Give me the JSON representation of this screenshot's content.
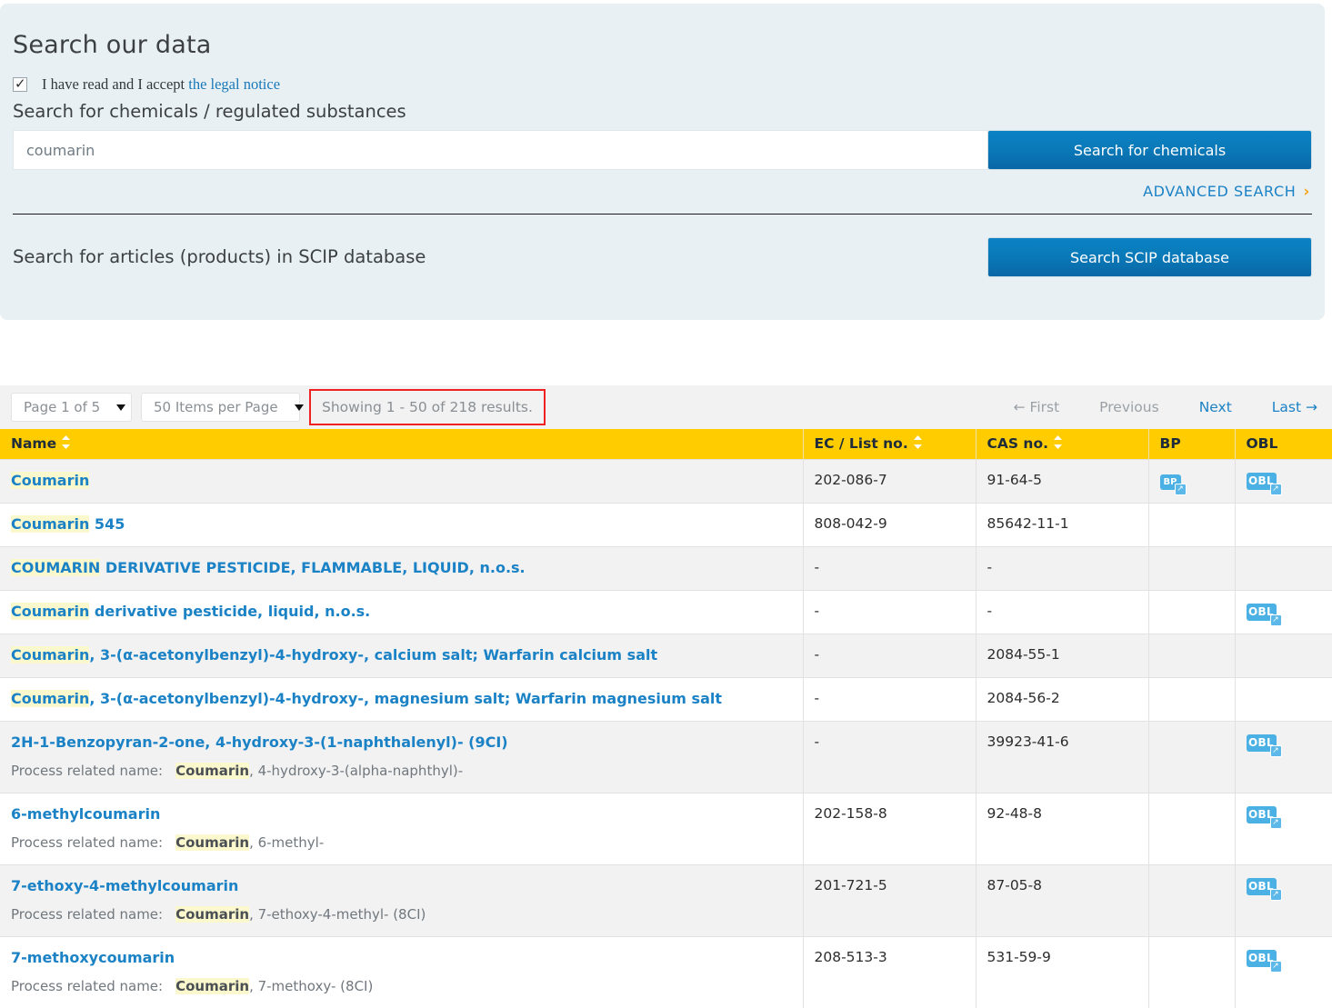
{
  "search_panel": {
    "title": "Search our data",
    "legal": {
      "checkbox_checked": true,
      "text_before": "I have read and I accept",
      "link_label": "the legal notice"
    },
    "chemicals_label": "Search for chemicals / regulated substances",
    "search_value": "coumarin",
    "search_placeholder": "",
    "search_button": "Search for chemicals",
    "advanced_search": "ADVANCED SEARCH",
    "advanced_arrow": "›",
    "scip_label": "Search for articles (products) in SCIP database",
    "scip_button": "Search SCIP database"
  },
  "toolbar": {
    "page_select": "Page 1 of 5",
    "items_per_page_select": "50 Items per Page",
    "showing": "Showing 1 - 50 of 218 results.",
    "pager": {
      "first": "← First",
      "previous": "Previous",
      "next": "Next",
      "last": "Last →"
    }
  },
  "table": {
    "headers": {
      "name": "Name",
      "ec": "EC / List no.",
      "cas": "CAS no.",
      "bp": "BP",
      "obl": "OBL"
    },
    "highlight_term": "Coumarin",
    "process_related_label": "Process related name:",
    "rows": [
      {
        "name_html": "<mark>Coumarin</mark>",
        "process_related_html": null,
        "ec": "202-086-7",
        "cas": "91-64-5",
        "bp": "BP",
        "obl": "OBL"
      },
      {
        "name_html": "<mark>Coumarin</mark> 545",
        "process_related_html": null,
        "ec": "808-042-9",
        "cas": "85642-11-1",
        "bp": null,
        "obl": null
      },
      {
        "name_html": "<mark>COUMARIN</mark> DERIVATIVE PESTICIDE, FLAMMABLE, LIQUID, n.o.s.",
        "process_related_html": null,
        "ec": "-",
        "cas": "-",
        "bp": null,
        "obl": null
      },
      {
        "name_html": "<mark>Coumarin</mark> derivative pesticide, liquid, n.o.s.",
        "process_related_html": null,
        "ec": "-",
        "cas": "-",
        "bp": null,
        "obl": "OBL"
      },
      {
        "name_html": "<mark>Coumarin</mark>, 3-(α-acetonylbenzyl)-4-hydroxy-, calcium salt; Warfarin calcium salt",
        "process_related_html": null,
        "ec": "-",
        "cas": "2084-55-1",
        "bp": null,
        "obl": null
      },
      {
        "name_html": "<mark>Coumarin</mark>, 3-(α-acetonylbenzyl)-4-hydroxy-, magnesium salt; Warfarin magnesium salt",
        "process_related_html": null,
        "ec": "-",
        "cas": "2084-56-2",
        "bp": null,
        "obl": null
      },
      {
        "name_html": "2H-1-Benzopyran-2-one, 4-hydroxy-3-(1-naphthalenyl)- (9CI)",
        "process_related_html": "<mark>Coumarin</mark>, 4-hydroxy-3-(alpha-naphthyl)-",
        "ec": "-",
        "cas": "39923-41-6",
        "bp": null,
        "obl": "OBL"
      },
      {
        "name_html": "6-methylcoumarin",
        "process_related_html": "<mark>Coumarin</mark>, 6-methyl-",
        "ec": "202-158-8",
        "cas": "92-48-8",
        "bp": null,
        "obl": "OBL"
      },
      {
        "name_html": "7-ethoxy-4-methylcoumarin",
        "process_related_html": "<mark>Coumarin</mark>, 7-ethoxy-4-methyl- (8CI)",
        "ec": "201-721-5",
        "cas": "87-05-8",
        "bp": null,
        "obl": "OBL"
      },
      {
        "name_html": "7-methoxycoumarin",
        "process_related_html": "<mark>Coumarin</mark>, 7-methoxy- (8CI)",
        "ec": "208-513-3",
        "cas": "531-59-9",
        "bp": null,
        "obl": "OBL"
      }
    ]
  },
  "colors": {
    "panel_bg": "#e9f0f3",
    "primary_button": "#0a73b2",
    "link_blue": "#1b82c6",
    "header_yellow": "#ffcc00",
    "highlight_yellow": "#fcf8cd",
    "badge_blue": "#4bb0e3",
    "annotation_red": "#ee2222",
    "row_alt_grey": "#f2f2f2"
  }
}
